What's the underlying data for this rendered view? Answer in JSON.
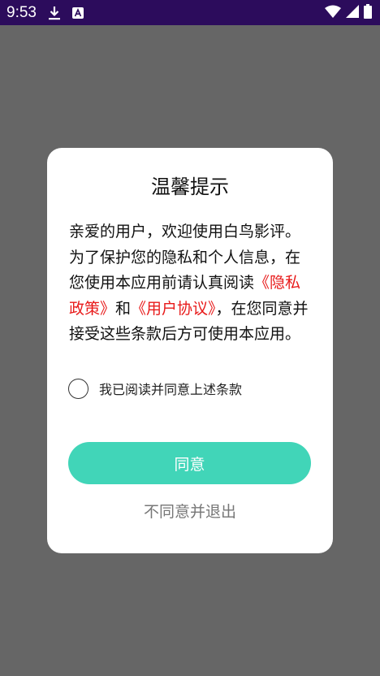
{
  "status_bar": {
    "time": "9:53",
    "icons": [
      "download-icon",
      "a-badge-icon",
      "wifi-icon",
      "signal-icon",
      "battery-icon"
    ]
  },
  "dialog": {
    "title": "温馨提示",
    "body": {
      "p1": "亲爱的用户，欢迎使用白鸟影评。为了保护您的隐私和个人信息，在您使用本应用前请认真阅读",
      "privacy_link": "《隐私政策》",
      "and": "和",
      "terms_link": "《用户协议》",
      "p2": "，在您同意并接受这些条款后方可使用本应用。"
    },
    "checkbox_label": "我已阅读并同意上述条款",
    "agree_button": "同意",
    "exit_button": "不同意并退出"
  },
  "colors": {
    "status_bar": "#2c0c5c",
    "backdrop": "#666666",
    "accent": "#41d5b8",
    "link": "#e81a1a"
  }
}
